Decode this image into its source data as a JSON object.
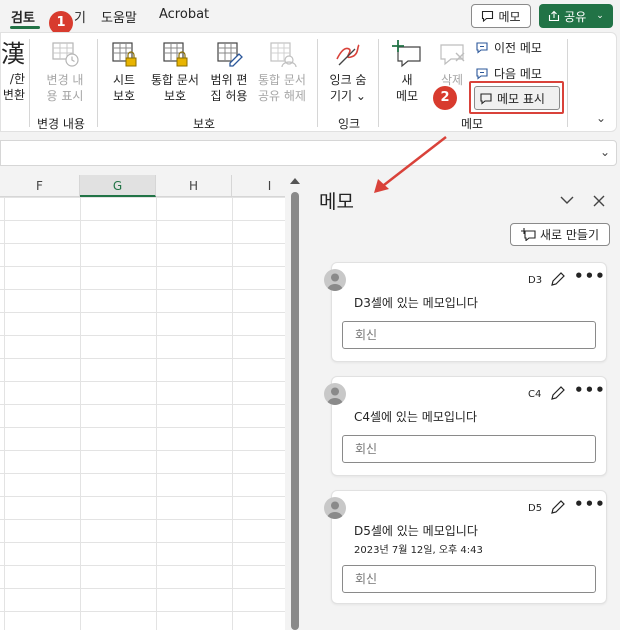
{
  "tabs": [
    {
      "label": "검토",
      "active": true
    },
    {
      "label": "기"
    },
    {
      "label": "도움말"
    },
    {
      "label": "Acrobat"
    }
  ],
  "callouts": [
    "1",
    "2"
  ],
  "top_buttons": {
    "memo_label": "메모",
    "share_label": "공유"
  },
  "ribbon": {
    "partial_button": {
      "line1": "漢",
      "line2": "/한",
      "line3": "변환"
    },
    "track_changes": {
      "line1": "변경 내",
      "line2": "용 표시",
      "group_label": "변경 내용"
    },
    "protect": {
      "sheet": {
        "line1": "시트",
        "line2": "보호"
      },
      "workbook": {
        "line1": "통합 문서",
        "line2": "보호"
      },
      "allow_edit": {
        "line1": "범위 편",
        "line2": "집 허용"
      },
      "unshare": {
        "line1": "통합 문서",
        "line2": "공유 해제"
      },
      "group_label": "보호"
    },
    "ink": {
      "line1": "잉크 숨",
      "line2": "기기",
      "group_label": "잉크"
    },
    "comments": {
      "new": {
        "line1": "새",
        "line2": "메모"
      },
      "delete": {
        "line1": "삭제"
      },
      "prev": "이전 메모",
      "next": "다음 메모",
      "show": "메모 표시",
      "group_label": "메모"
    }
  },
  "grid": {
    "columns": [
      "F",
      "G",
      "H",
      "I"
    ],
    "selected_column": "G"
  },
  "pane": {
    "title": "메모",
    "new_comment_label": "새로 만들기",
    "comments": [
      {
        "cell": "D3",
        "text": "D3셀에 있는 메모입니다",
        "time": "",
        "reply_placeholder": "회신"
      },
      {
        "cell": "C4",
        "text": "C4셀에 있는 메모입니다",
        "time": "",
        "reply_placeholder": "회신"
      },
      {
        "cell": "D5",
        "text": "D5셀에 있는 메모입니다",
        "time": "2023년 7월 12일, 오후 4:43",
        "reply_placeholder": "회신"
      }
    ]
  },
  "colors": {
    "accent": "#217346",
    "callout": "#d83b2e",
    "highlight": "#d9423a"
  }
}
